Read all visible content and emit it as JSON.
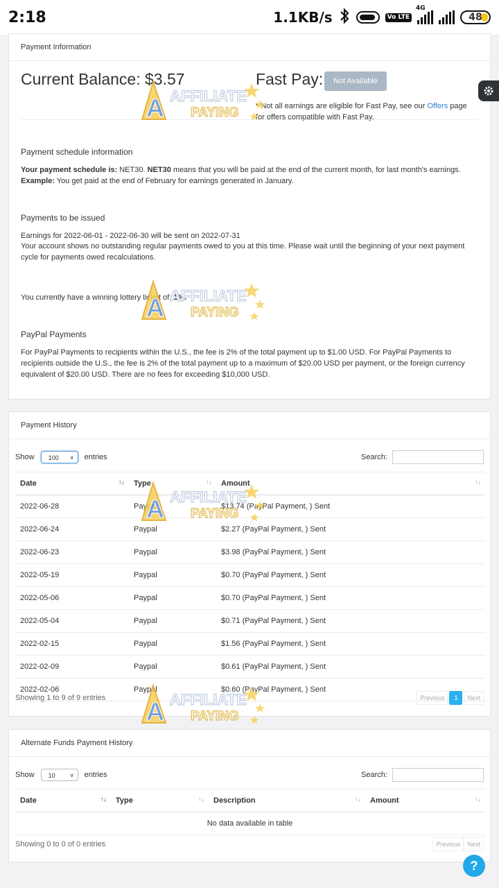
{
  "status_bar": {
    "time": "2:18",
    "speed": "1.1KB/s",
    "volte": "Vo LTE",
    "net": "4G",
    "battery": "48"
  },
  "payment_info": {
    "header": "Payment Information",
    "balance_label": "Current Balance:",
    "balance_value": "$3.57",
    "fastpay_label": "Fast Pay:",
    "fastpay_button": "Not Available",
    "fastpay_note_star": "*",
    "fastpay_note_a": "Not all earnings are eligible for Fast Pay, see our",
    "fastpay_note_link": "Offers",
    "fastpay_note_b": "page for offers compatible with Fast Pay.",
    "schedule_title": "Payment schedule information",
    "schedule_bold1": "Your payment schedule is:",
    "schedule_text1": "NET30.",
    "schedule_bold2": "NET30",
    "schedule_text2": "means that you will be paid at the end of the current month, for last month's earnings.",
    "schedule_bold3": "Example:",
    "schedule_text3": "You get paid at the end of February for earnings generated in January.",
    "issued_title": "Payments to be issued",
    "issued_line1": "Earnings for 2022-06-01 - 2022-06-30 will be sent on 2022-07-31",
    "issued_line2": "Your account shows no outstanding regular payments owed to you at this time. Please wait until the beginning of your next payment cycle for payments owed recalculations.",
    "lottery_text": "You currently have a winning lottery ticket of:",
    "lottery_value": "1%.",
    "paypal_title": "PayPal Payments",
    "paypal_text": "For PayPal Payments to recipients within the U.S., the fee is 2% of the total payment up to $1.00 USD. For PayPal Payments to recipients outside the U.S., the fee is 2% of the total payment up to a maximum of $20.00 USD per payment, or the foreign currency equivalent of $20.00 USD. There are no fees for exceeding $10,000 USD."
  },
  "payment_history": {
    "header": "Payment History",
    "show": "Show",
    "entries_value": "100",
    "entries": "entries",
    "search": "Search:",
    "columns": [
      "Date",
      "Type",
      "Amount"
    ],
    "rows": [
      [
        "2022-06-28",
        "Paypal",
        "$13.74 (PayPal Payment, ) Sent"
      ],
      [
        "2022-06-24",
        "Paypal",
        "$2.27 (PayPal Payment, ) Sent"
      ],
      [
        "2022-06-23",
        "Paypal",
        "$3.98 (PayPal Payment, ) Sent"
      ],
      [
        "2022-05-19",
        "Paypal",
        "$0.70 (PayPal Payment, ) Sent"
      ],
      [
        "2022-05-06",
        "Paypal",
        "$0.70 (PayPal Payment, ) Sent"
      ],
      [
        "2022-05-04",
        "Paypal",
        "$0.71 (PayPal Payment, ) Sent"
      ],
      [
        "2022-02-15",
        "Paypal",
        "$1.56 (PayPal Payment, ) Sent"
      ],
      [
        "2022-02-09",
        "Paypal",
        "$0.61 (PayPal Payment, ) Sent"
      ],
      [
        "2022-02-06",
        "Paypal",
        "$0.60 (PayPal Payment, ) Sent"
      ]
    ],
    "showing": "Showing 1 to 9 of 9 entries",
    "prev": "Previous",
    "page": "1",
    "next": "Next"
  },
  "alt_history": {
    "header": "Alternate Funds Payment History",
    "show": "Show",
    "entries_value": "10",
    "entries": "entries",
    "search": "Search:",
    "columns": [
      "Date",
      "Type",
      "Description",
      "Amount"
    ],
    "empty": "No data available in table",
    "showing": "Showing 0 to 0 of 0 entries",
    "prev": "Previous",
    "next": "Next"
  },
  "watermark": {
    "line1": "AFFILIATE",
    "line2": "PAYING",
    "letter": "A"
  },
  "help": "?"
}
